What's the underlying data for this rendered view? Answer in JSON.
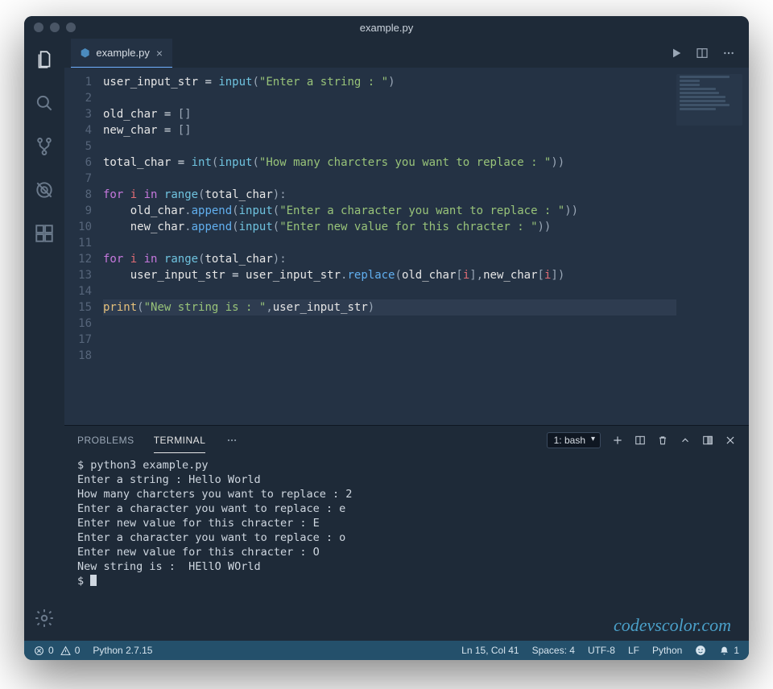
{
  "title": "example.py",
  "tab": {
    "filename": "example.py"
  },
  "activity": {
    "items": [
      "explorer",
      "search",
      "scm",
      "debug",
      "extensions"
    ]
  },
  "editor": {
    "lineCount": 18,
    "highlightLine": 15,
    "tokens": [
      [
        [
          "var",
          "user_input_str"
        ],
        [
          "op",
          " = "
        ],
        [
          "builtin",
          "input"
        ],
        [
          "punc",
          "("
        ],
        [
          "str",
          "\"Enter a string : \""
        ],
        [
          "punc",
          ")"
        ]
      ],
      [],
      [
        [
          "var",
          "old_char"
        ],
        [
          "op",
          " = "
        ],
        [
          "punc",
          "[]"
        ]
      ],
      [
        [
          "var",
          "new_char"
        ],
        [
          "op",
          " = "
        ],
        [
          "punc",
          "[]"
        ]
      ],
      [],
      [
        [
          "var",
          "total_char"
        ],
        [
          "op",
          " = "
        ],
        [
          "builtin",
          "int"
        ],
        [
          "punc",
          "("
        ],
        [
          "builtin",
          "input"
        ],
        [
          "punc",
          "("
        ],
        [
          "str",
          "\"How many charcters you want to replace : \""
        ],
        [
          "punc",
          "))"
        ]
      ],
      [],
      [
        [
          "kw",
          "for"
        ],
        [
          "op",
          " "
        ],
        [
          "id",
          "i"
        ],
        [
          "op",
          " "
        ],
        [
          "kw",
          "in"
        ],
        [
          "op",
          " "
        ],
        [
          "builtin",
          "range"
        ],
        [
          "punc",
          "("
        ],
        [
          "var",
          "total_char"
        ],
        [
          "punc",
          ")"
        ],
        [
          "punc",
          ":"
        ]
      ],
      [
        [
          "op",
          "    "
        ],
        [
          "var",
          "old_char"
        ],
        [
          "punc",
          "."
        ],
        [
          "method",
          "append"
        ],
        [
          "punc",
          "("
        ],
        [
          "builtin",
          "input"
        ],
        [
          "punc",
          "("
        ],
        [
          "str",
          "\"Enter a character you want to replace : \""
        ],
        [
          "punc",
          "))"
        ]
      ],
      [
        [
          "op",
          "    "
        ],
        [
          "var",
          "new_char"
        ],
        [
          "punc",
          "."
        ],
        [
          "method",
          "append"
        ],
        [
          "punc",
          "("
        ],
        [
          "builtin",
          "input"
        ],
        [
          "punc",
          "("
        ],
        [
          "str",
          "\"Enter new value for this chracter : \""
        ],
        [
          "punc",
          "))"
        ]
      ],
      [],
      [
        [
          "kw",
          "for"
        ],
        [
          "op",
          " "
        ],
        [
          "id",
          "i"
        ],
        [
          "op",
          " "
        ],
        [
          "kw",
          "in"
        ],
        [
          "op",
          " "
        ],
        [
          "builtin",
          "range"
        ],
        [
          "punc",
          "("
        ],
        [
          "var",
          "total_char"
        ],
        [
          "punc",
          ")"
        ],
        [
          "punc",
          ":"
        ]
      ],
      [
        [
          "op",
          "    "
        ],
        [
          "var",
          "user_input_str"
        ],
        [
          "op",
          " = "
        ],
        [
          "var",
          "user_input_str"
        ],
        [
          "punc",
          "."
        ],
        [
          "method",
          "replace"
        ],
        [
          "punc",
          "("
        ],
        [
          "var",
          "old_char"
        ],
        [
          "punc",
          "["
        ],
        [
          "id",
          "i"
        ],
        [
          "punc",
          "],"
        ],
        [
          "var",
          "new_char"
        ],
        [
          "punc",
          "["
        ],
        [
          "id",
          "i"
        ],
        [
          "punc",
          "])"
        ]
      ],
      [],
      [
        [
          "print",
          "print"
        ],
        [
          "punc",
          "("
        ],
        [
          "str",
          "\"New string is : \""
        ],
        [
          "punc",
          ","
        ],
        [
          "var",
          "user_input_str"
        ],
        [
          "punc",
          ")"
        ]
      ],
      [],
      [],
      []
    ]
  },
  "panel": {
    "tabs": {
      "problems": "PROBLEMS",
      "terminal": "TERMINAL"
    },
    "terminalSelector": "1: bash",
    "terminalLines": [
      "$ python3 example.py",
      "Enter a string : Hello World",
      "How many charcters you want to replace : 2",
      "Enter a character you want to replace : e",
      "Enter new value for this chracter : E",
      "Enter a character you want to replace : o",
      "Enter new value for this chracter : O",
      "New string is :  HEllO WOrld",
      "$ "
    ]
  },
  "watermark": "codevscolor.com",
  "statusbar": {
    "errors": "0",
    "warnings": "0",
    "python": "Python 2.7.15",
    "cursor": "Ln 15, Col 41",
    "spaces": "Spaces: 4",
    "encoding": "UTF-8",
    "eol": "LF",
    "lang": "Python",
    "bell": "1"
  }
}
